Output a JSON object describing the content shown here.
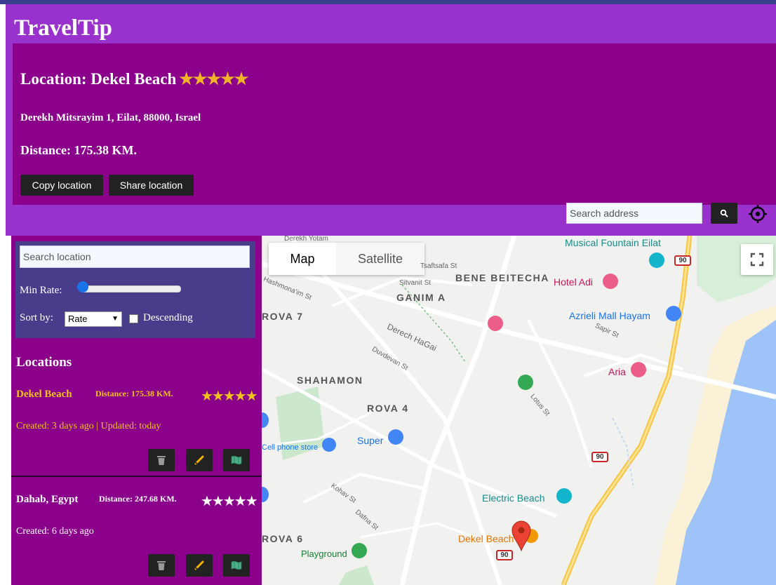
{
  "app": {
    "title": "TravelTip"
  },
  "location_card": {
    "title": "Location: Dekel Beach",
    "stars": "★★★★★",
    "address": "Derekh Mitsrayim 1, Eilat, 88000, Israel",
    "distance": "Distance: 175.38 KM.",
    "copy_label": "Copy location",
    "share_label": "Share location"
  },
  "search": {
    "placeholder": "Search address",
    "icon": "search-icon",
    "locate_icon": "crosshair-icon"
  },
  "filters": {
    "search_placeholder": "Search location",
    "min_rate_label": "Min Rate:",
    "min_rate_value": 0,
    "sort_label": "Sort by:",
    "sort_selected": "Rate",
    "descending_label": "Descending",
    "descending_checked": false
  },
  "locations": {
    "heading": "Locations",
    "items": [
      {
        "name": "Dekel Beach",
        "distance": "Distance: 175.38 KM.",
        "stars": "★★★★★",
        "meta": "Created: 3 days ago | Updated: today",
        "highlighted": true
      },
      {
        "name": "Dahab, Egypt",
        "distance": "Distance: 247.68 KM.",
        "stars": "★★★★★",
        "meta": "Created: 6 days ago",
        "highlighted": false
      }
    ]
  },
  "map": {
    "map_label": "Map",
    "satellite_label": "Satellite",
    "labels": {
      "musical_fountain": "Musical Fountain Eilat",
      "derekh_yotam": "Derekh Yotam",
      "saftsafa": "Tsaftsafa St",
      "sitvanit": "Sitvanit St",
      "bene_beitecha": "BENE BEITECHA",
      "hotel_adi": "Hotel Adi",
      "ganim_a": "GANIM A",
      "hashmonaim": "Hashmona'im St",
      "rova_7": "ROVA 7",
      "azrieli": "Azrieli Mall Hayam",
      "sapir": "Sapir St",
      "derech_hagai": "Derech HaGai",
      "duvdevan": "Duvdevan St",
      "aria": "Aria",
      "shahamon": "SHAHAMON",
      "rova_4": "ROVA 4",
      "lotus": "Lotus St",
      "super": "Super",
      "cell_phone": "Cell phone store",
      "kohav": "Kohav St",
      "dafna": "Dafna St",
      "electric_beach": "Electric Beach",
      "rova_6": "ROVA 6",
      "playground": "Playground",
      "dekel_beach": "Dekel Beach",
      "route_90": "90"
    }
  }
}
